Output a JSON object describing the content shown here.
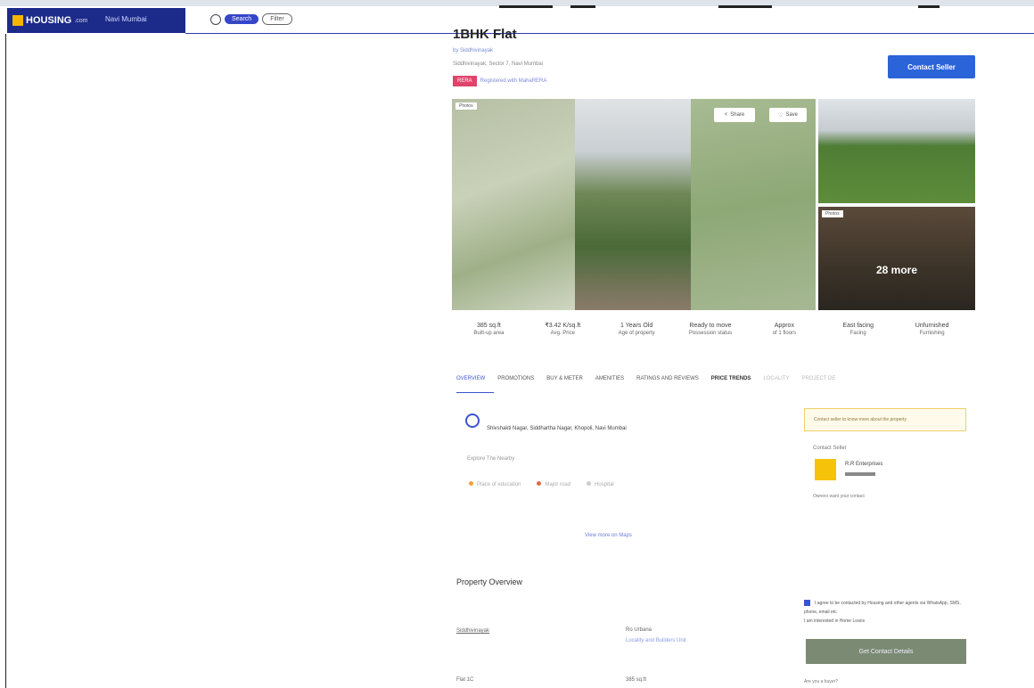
{
  "header": {
    "logo_text": "HOUSING",
    "logo_suffix": ".com",
    "city": "Navi Mumbai",
    "search_chip": "Search",
    "filter_chip": "Filter"
  },
  "listing": {
    "title": "1BHK Flat",
    "byline": "by Siddhivinayak",
    "location": "Siddhivinayak, Sector 7, Navi Mumbai",
    "rera_tag": "RERA",
    "rera_text": "Registered with MahaRERA",
    "price_right": "",
    "contact_seller": "Contact Seller"
  },
  "gallery": {
    "photo_tag": "Photos",
    "share_label": "Share",
    "save_label": "Save",
    "side2_tag": "Photos",
    "more_label": "28 more"
  },
  "stats": [
    {
      "value": "385 sq.ft",
      "label": "Built-up area"
    },
    {
      "value": "₹3.42 K/sq.ft",
      "label": "Avg. Price"
    },
    {
      "value": "1 Years Old",
      "label": "Age of property"
    },
    {
      "value": "Ready to move",
      "label": "Possession status"
    },
    {
      "value": "Approx",
      "label": "of 1 floors"
    },
    {
      "value": "East facing",
      "label": "Facing"
    },
    {
      "value": "Unfurnished",
      "label": "Furnishing"
    }
  ],
  "tabs": [
    "OVERVIEW",
    "PROMOTIONS",
    "BUY & METER",
    "AMENITIES",
    "RATINGS AND REVIEWS",
    "PRICE TRENDS",
    "LOCALITY",
    "PROJECT DE"
  ],
  "location": {
    "address": "Shivshakti Nagar, Siddhartha Nagar, Khopoli, Navi Mumbai",
    "explore": "Explore The Nearby",
    "near": [
      "Place of education",
      "Major road",
      "Hospital"
    ],
    "view_more": "View more on Maps"
  },
  "overview": {
    "title": "Property Overview",
    "left_label": "Siddhivinayak",
    "right_label": "Ro Urbana",
    "right_sub": "Locality and Builders Unit",
    "bottom_left": "Flat 1C",
    "bottom_right": "385 sq.ft"
  },
  "contact_panel": {
    "note": "Contact seller to know more about the property",
    "label": "Contact Seller",
    "seller_name": "R.R Enterprises",
    "seller_note": "Owners want your contact",
    "agree_text": "I agree to be contacted by Housing and other agents via WhatsApp, SMS, phone, email etc",
    "agree_sub": "I am interested in Home Loans",
    "get_button": "Get Contact Details",
    "not_interested": "Are you a buyer?"
  }
}
